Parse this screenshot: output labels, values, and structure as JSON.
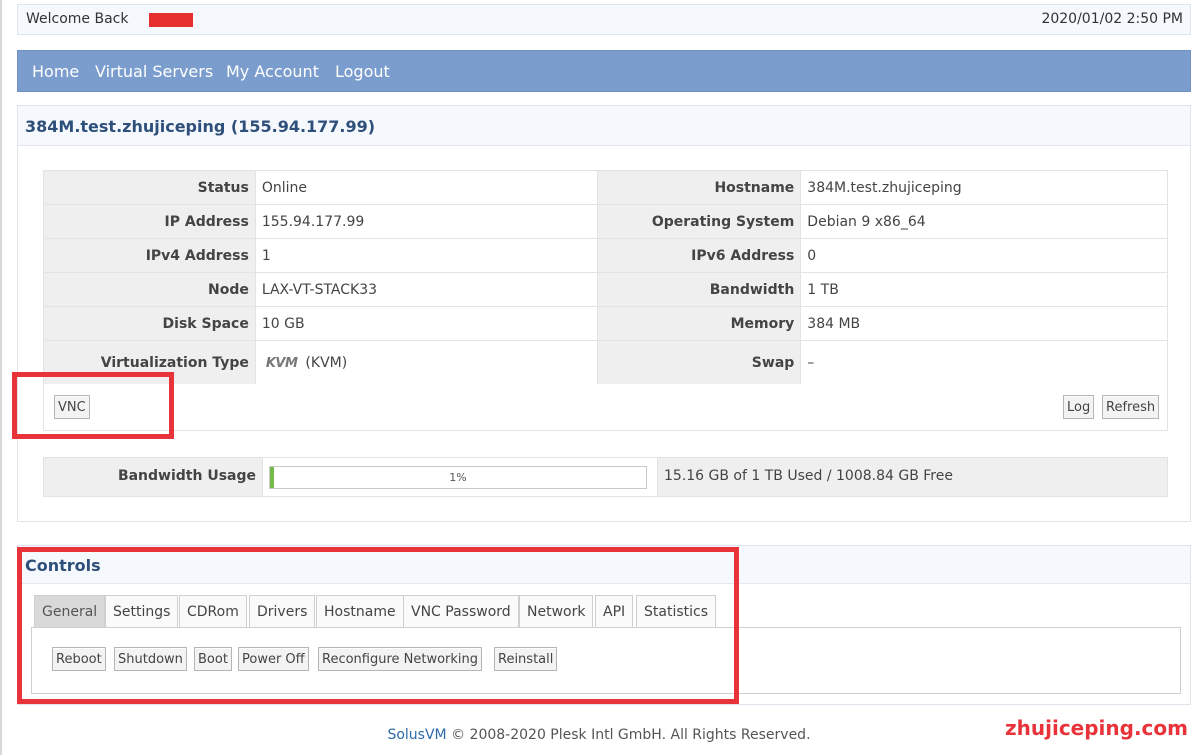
{
  "header": {
    "welcome": "Welcome Back",
    "datetime": "2020/01/02 2:50 PM"
  },
  "nav": {
    "items": [
      "Home",
      "Virtual Servers",
      "My Account",
      "Logout"
    ]
  },
  "server": {
    "title": "384M.test.zhujiceping (155.94.177.99)",
    "rows": [
      {
        "l1": "Status",
        "v1": "Online",
        "l2": "Hostname",
        "v2": "384M.test.zhujiceping"
      },
      {
        "l1": "IP Address",
        "v1": "155.94.177.99",
        "l2": "Operating System",
        "v2": "Debian 9 x86_64"
      },
      {
        "l1": "IPv4 Address",
        "v1": "1",
        "l2": "IPv6 Address",
        "v2": "0"
      },
      {
        "l1": "Node",
        "v1": "LAX-VT-STACK33",
        "l2": "Bandwidth",
        "v2": "1 TB"
      },
      {
        "l1": "Disk Space",
        "v1": "10 GB",
        "l2": "Memory",
        "v2": "384 MB"
      },
      {
        "l1": "Virtualization Type",
        "v1_logo": "KVM",
        "v1": "(KVM)",
        "l2": "Swap",
        "v2": "–"
      }
    ],
    "buttons": {
      "vnc": "VNC",
      "log": "Log",
      "refresh": "Refresh"
    },
    "bandwidth": {
      "label": "Bandwidth Usage",
      "percent_label": "1%",
      "percent": 0.01,
      "summary": "15.16 GB of 1 TB Used / 1008.84 GB Free"
    }
  },
  "controls": {
    "title": "Controls",
    "tabs": [
      "General",
      "Settings",
      "CDRom",
      "Drivers",
      "Hostname",
      "VNC Password",
      "Network",
      "API",
      "Statistics"
    ],
    "active_tab": "General",
    "actions": [
      "Reboot",
      "Shutdown",
      "Boot",
      "Power Off",
      "Reconfigure Networking",
      "Reinstall"
    ]
  },
  "footer": {
    "brand": "SolusVM",
    "text": "© 2008-2020 Plesk Intl GmbH. All Rights Reserved."
  },
  "watermark": "zhujiceping.com",
  "colors": {
    "nav": "#7b9dcd",
    "title": "#2d4f7a",
    "online": "#2a9a2a",
    "highlight": "#e8333a",
    "progress": "#76b84a"
  }
}
